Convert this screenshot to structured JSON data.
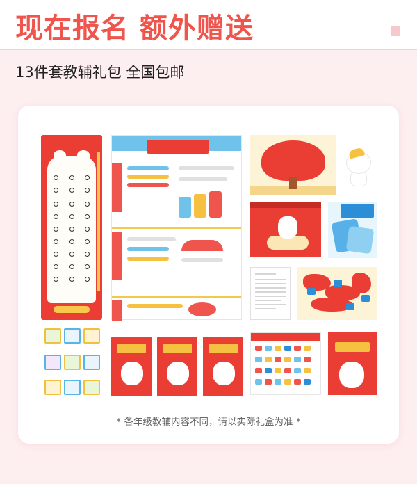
{
  "header": {
    "headline": "现在报名 额外赠送",
    "subline": "13件套教辅礼包  全国包邮"
  },
  "card": {
    "note": "* 各年级教辅内容不同，请以实际礼盒为准 *"
  },
  "colors": {
    "accent_red": "#f0554d",
    "brand_red": "#ea3d33",
    "yellow": "#f6c140",
    "sky_blue": "#6fc3ea",
    "page_pink": "#fdeef0"
  },
  "icons": {
    "corner_square": "square-icon"
  }
}
